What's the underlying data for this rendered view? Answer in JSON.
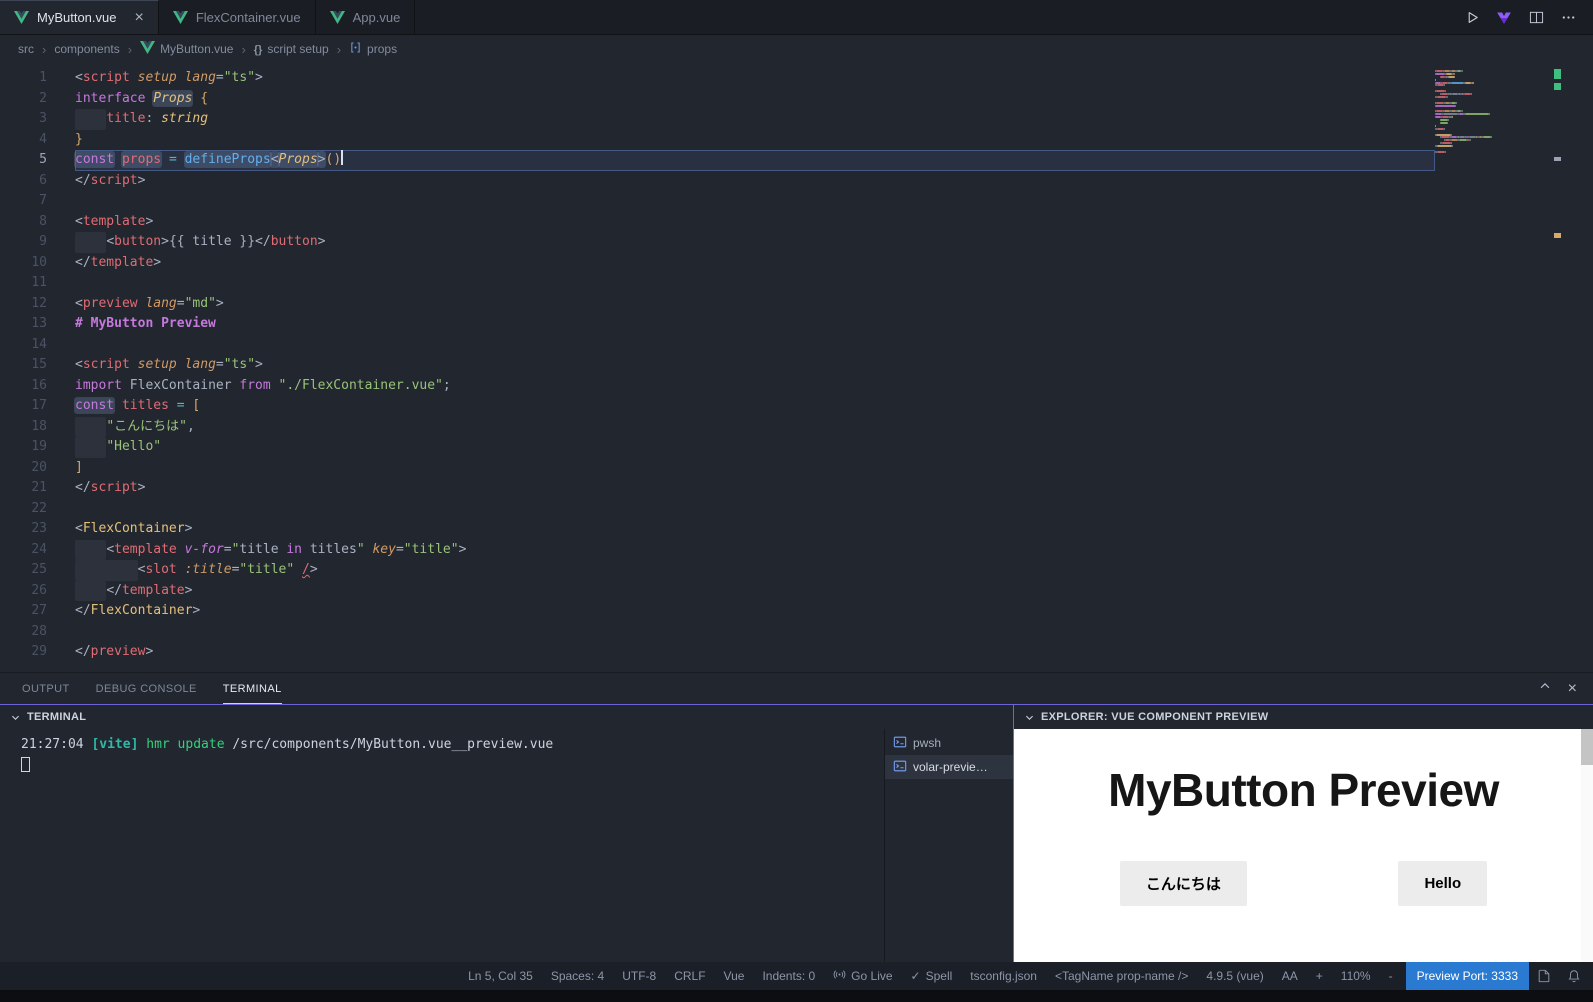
{
  "tabs": {
    "items": [
      {
        "label": "MyButton.vue",
        "active": true,
        "closable": true
      },
      {
        "label": "FlexContainer.vue",
        "active": false
      },
      {
        "label": "App.vue",
        "active": false
      }
    ],
    "actions": [
      {
        "icon": "play",
        "name": "run-button"
      },
      {
        "icon": "volar",
        "name": "volar-preview-button"
      },
      {
        "icon": "split-editor",
        "name": "split-editor-button"
      },
      {
        "icon": "ellipsis",
        "name": "more-actions-button"
      }
    ]
  },
  "breadcrumb": {
    "separator": "›",
    "items": [
      {
        "label": "src"
      },
      {
        "label": "components"
      },
      {
        "label": "MyButton.vue",
        "icon": "vue"
      },
      {
        "label": "script setup",
        "icon": "braces"
      },
      {
        "label": "props",
        "icon": "symbol-prop"
      }
    ]
  },
  "editor": {
    "active_line": 5,
    "lines": [
      [
        [
          "<",
          "pu"
        ],
        [
          "script",
          "tag"
        ],
        [
          " ",
          "pu"
        ],
        [
          "setup",
          "attr"
        ],
        [
          " ",
          "pu"
        ],
        [
          "lang",
          "attr"
        ],
        [
          "=",
          "pu"
        ],
        [
          "\"ts\"",
          "str"
        ],
        [
          ">",
          "pu"
        ]
      ],
      [
        [
          "interface",
          "kw"
        ],
        [
          " ",
          "pu"
        ],
        [
          "Props",
          "type hl"
        ],
        [
          " ",
          "pu"
        ],
        [
          "{",
          "br"
        ]
      ],
      [
        [
          "    ",
          "ind"
        ],
        [
          "title",
          "var"
        ],
        [
          ": ",
          "pu"
        ],
        [
          "string",
          "type"
        ]
      ],
      [
        [
          "}",
          "br"
        ]
      ],
      [
        [
          "const",
          "kw hl"
        ],
        [
          " ",
          "pu"
        ],
        [
          "props",
          "var hl"
        ],
        [
          " ",
          "pu"
        ],
        [
          "=",
          "op"
        ],
        [
          " ",
          "pu"
        ],
        [
          "defineProps",
          "fn hl"
        ],
        [
          "<",
          "pu hl"
        ],
        [
          "Props",
          "type hl"
        ],
        [
          ">",
          "pu hl"
        ],
        [
          "(",
          "br"
        ],
        [
          ")",
          "br"
        ]
      ],
      [
        [
          "</",
          "pu"
        ],
        [
          "script",
          "tag"
        ],
        [
          ">",
          "pu"
        ]
      ],
      [],
      [
        [
          "<",
          "pu"
        ],
        [
          "template",
          "tag"
        ],
        [
          ">",
          "pu"
        ]
      ],
      [
        [
          "    ",
          "ind"
        ],
        [
          "<",
          "pu"
        ],
        [
          "button",
          "tag"
        ],
        [
          ">",
          "pu"
        ],
        [
          "{{ ",
          "pu"
        ],
        [
          "title",
          "fg"
        ],
        [
          " }}",
          "pu"
        ],
        [
          "</",
          "pu"
        ],
        [
          "button",
          "tag"
        ],
        [
          ">",
          "pu"
        ]
      ],
      [
        [
          "</",
          "pu"
        ],
        [
          "template",
          "tag"
        ],
        [
          ">",
          "pu"
        ]
      ],
      [],
      [
        [
          "<",
          "pu"
        ],
        [
          "preview",
          "tag"
        ],
        [
          " ",
          "pu"
        ],
        [
          "lang",
          "attr"
        ],
        [
          "=",
          "pu"
        ],
        [
          "\"md\"",
          "str"
        ],
        [
          ">",
          "pu"
        ]
      ],
      [
        [
          "# MyButton Preview",
          "md"
        ]
      ],
      [],
      [
        [
          "<",
          "pu"
        ],
        [
          "script",
          "tag"
        ],
        [
          " ",
          "pu"
        ],
        [
          "setup",
          "attr"
        ],
        [
          " ",
          "pu"
        ],
        [
          "lang",
          "attr"
        ],
        [
          "=",
          "pu"
        ],
        [
          "\"ts\"",
          "str"
        ],
        [
          ">",
          "pu"
        ]
      ],
      [
        [
          "import",
          "kw"
        ],
        [
          " ",
          "pu"
        ],
        [
          "FlexContainer",
          "fg"
        ],
        [
          " ",
          "pu"
        ],
        [
          "from",
          "kw"
        ],
        [
          " ",
          "pu"
        ],
        [
          "\"./FlexContainer.vue\"",
          "str"
        ],
        [
          ";",
          "pu"
        ]
      ],
      [
        [
          "const",
          "kw hl"
        ],
        [
          " ",
          "pu"
        ],
        [
          "titles",
          "var"
        ],
        [
          " ",
          "pu"
        ],
        [
          "=",
          "op"
        ],
        [
          " ",
          "pu"
        ],
        [
          "[",
          "br"
        ]
      ],
      [
        [
          "    ",
          "ind"
        ],
        [
          "\"こんにちは\"",
          "str"
        ],
        [
          ",",
          "pu"
        ]
      ],
      [
        [
          "    ",
          "ind"
        ],
        [
          "\"Hello\"",
          "str"
        ]
      ],
      [
        [
          "]",
          "br"
        ]
      ],
      [
        [
          "</",
          "pu"
        ],
        [
          "script",
          "tag"
        ],
        [
          ">",
          "pu"
        ]
      ],
      [],
      [
        [
          "<",
          "pu"
        ],
        [
          "FlexContainer",
          "comp"
        ],
        [
          ">",
          "pu"
        ]
      ],
      [
        [
          "    ",
          "ind"
        ],
        [
          "<",
          "pu"
        ],
        [
          "template",
          "tag"
        ],
        [
          " ",
          "pu"
        ],
        [
          "v-for",
          "dir"
        ],
        [
          "=",
          "pu"
        ],
        [
          "\"",
          "str"
        ],
        [
          "title",
          "fg"
        ],
        [
          " ",
          "pu"
        ],
        [
          "in",
          "kw"
        ],
        [
          " ",
          "pu"
        ],
        [
          "titles",
          "fg"
        ],
        [
          "\"",
          "str"
        ],
        [
          " ",
          "pu"
        ],
        [
          "key",
          "attr"
        ],
        [
          "=",
          "pu"
        ],
        [
          "\"title\"",
          "str"
        ],
        [
          ">",
          "pu"
        ]
      ],
      [
        [
          "        ",
          "ind"
        ],
        [
          "<",
          "pu"
        ],
        [
          "slot",
          "tag"
        ],
        [
          " ",
          "pu"
        ],
        [
          ":title",
          "attr"
        ],
        [
          "=",
          "pu"
        ],
        [
          "\"title\"",
          "str"
        ],
        [
          " ",
          "pu"
        ],
        [
          "/",
          "err"
        ],
        [
          ">",
          "pu"
        ]
      ],
      [
        [
          "    ",
          "ind"
        ],
        [
          "</",
          "pu"
        ],
        [
          "template",
          "tag"
        ],
        [
          ">",
          "pu"
        ]
      ],
      [
        [
          "</",
          "pu"
        ],
        [
          "FlexContainer",
          "comp"
        ],
        [
          ">",
          "pu"
        ]
      ],
      [],
      [
        [
          "</",
          "pu"
        ],
        [
          "preview",
          "tag"
        ],
        [
          ">",
          "pu"
        ]
      ]
    ]
  },
  "panel": {
    "tabs": [
      {
        "label": "OUTPUT",
        "active": false
      },
      {
        "label": "DEBUG CONSOLE",
        "active": false
      },
      {
        "label": "TERMINAL",
        "active": true
      }
    ],
    "terminal": {
      "title": "TERMINAL",
      "log": [
        [
          "21:27:04 ",
          "t-fg"
        ],
        [
          "[vite]",
          "t-vite"
        ],
        [
          " ",
          "t-fg"
        ],
        [
          "hmr update ",
          "t-grn"
        ],
        [
          "/src/components/MyButton.vue__preview.vue",
          "t-fg"
        ]
      ]
    },
    "shells": [
      {
        "label": "pwsh",
        "active": false
      },
      {
        "label": "volar-previe…",
        "active": true
      }
    ],
    "preview": {
      "title": "EXPLORER: VUE COMPONENT PREVIEW",
      "heading": "MyButton Preview",
      "buttons": [
        "こんにちは",
        "Hello"
      ]
    }
  },
  "status_bar": {
    "items": [
      {
        "label": "Ln 5, Col 35"
      },
      {
        "label": "Spaces: 4"
      },
      {
        "label": "UTF-8"
      },
      {
        "label": "CRLF"
      },
      {
        "label": "Vue"
      },
      {
        "label": "Indents: 0"
      },
      {
        "label": "Go Live",
        "icon": "broadcast"
      },
      {
        "label": "Spell",
        "icon": "check"
      },
      {
        "label": "tsconfig.json"
      },
      {
        "label": "<TagName prop-name />"
      },
      {
        "label": "4.9.5 (vue)"
      },
      {
        "label": "AA"
      },
      {
        "label": "+"
      },
      {
        "label": "110%"
      },
      {
        "label": "-"
      },
      {
        "label": "Preview Port: 3333",
        "accent": true
      }
    ],
    "icons": [
      {
        "icon": "preview-pane",
        "name": "preview-file-icon"
      },
      {
        "icon": "bell",
        "name": "notifications-icon"
      }
    ]
  }
}
